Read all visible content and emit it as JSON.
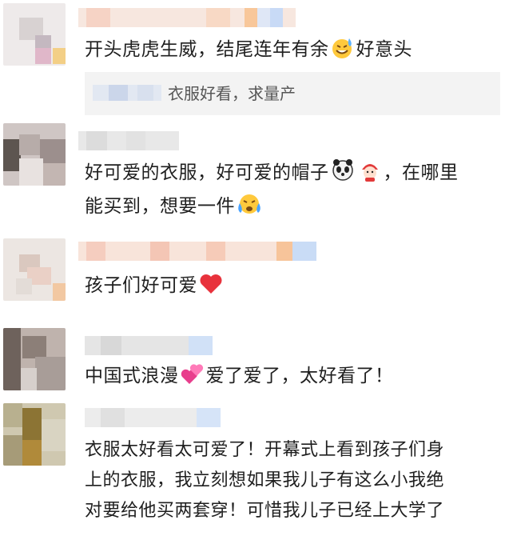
{
  "comments": [
    {
      "text_before": "开头虎虎生威，结尾连年有余",
      "text_after": "好意头",
      "reply": {
        "text": "衣服好看，求量产"
      }
    },
    {
      "line1_before": "好可爱的衣服，好可爱的帽子",
      "line1_after": "，在哪里",
      "line2": "能买到，想要一件"
    },
    {
      "text": "孩子们好可爱"
    },
    {
      "text_before": "中国式浪漫",
      "text_after": "爱了爱了，太好看了！"
    },
    {
      "line1": "衣服太好看太可爱了！开幕式上看到孩子们身",
      "line2": "上的衣服，我立刻想如果我儿子有这么小我绝",
      "line3": "对要给他买两套穿！可惜我儿子已经上大学了"
    }
  ],
  "icons": {
    "sweat-smile": "sweat-smile-emoji",
    "panda": "panda-emoji",
    "hat": "red-hat-mascot-emoji",
    "cry": "crying-emoji",
    "heart": "red-heart-emoji",
    "two-hearts": "two-hearts-emoji"
  },
  "colors": {
    "text": "#1f1f1f",
    "reply_bg": "#f3f3f3",
    "reply_text": "#555555",
    "heart": "#e8323c",
    "pink": "#e83e8c"
  }
}
